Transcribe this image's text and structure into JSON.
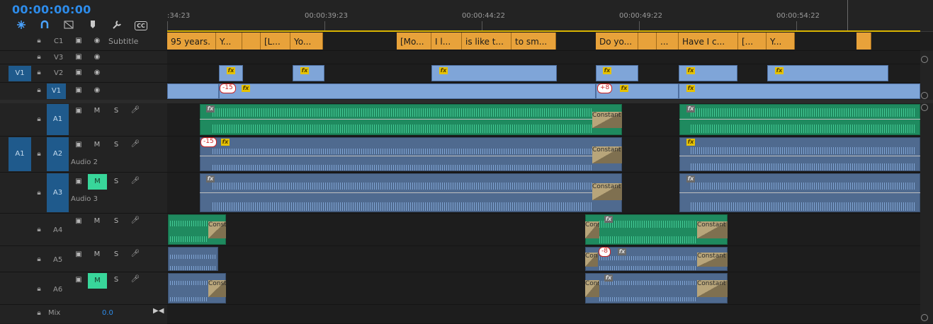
{
  "timecode": "00:00:00:00",
  "toolbar": {
    "snap_icon": "snap-icon",
    "link_icon": "linked-selection-icon",
    "insert_icon": "insert-overwrite-icon",
    "marker_icon": "add-marker-icon",
    "settings_icon": "wrench-icon",
    "captions_label": "CC"
  },
  "ruler": {
    "labels": [
      ":34:23",
      "00:00:39:23",
      "00:00:44:22",
      "00:00:49:22",
      "00:00:54:22"
    ]
  },
  "tracks": {
    "c1": {
      "name": "C1",
      "label": "Subtitle"
    },
    "v3": {
      "name": "V3"
    },
    "v2": {
      "name": "V2",
      "source": "V1"
    },
    "v1": {
      "name": "V1"
    },
    "a1": {
      "name": "A1",
      "mute": "M",
      "solo": "S"
    },
    "a2": {
      "name": "A2",
      "source": "A1",
      "mute": "M",
      "solo": "S",
      "label": "Audio 2"
    },
    "a3": {
      "name": "A3",
      "mute": "M",
      "solo": "S",
      "label": "Audio 3"
    },
    "a4": {
      "name": "A4",
      "mute": "M",
      "solo": "S"
    },
    "a5": {
      "name": "A5",
      "mute": "M",
      "solo": "S"
    },
    "a6": {
      "name": "A6",
      "mute": "M",
      "solo": "S"
    }
  },
  "mix": {
    "label": "Mix",
    "value": "0.0"
  },
  "captions": [
    {
      "text": "95 years."
    },
    {
      "text": "Y..."
    },
    {
      "text": "[L..."
    },
    {
      "text": "Yo..."
    },
    {
      "text": "[Mo..."
    },
    {
      "text": "I l..."
    },
    {
      "text": "is like t..."
    },
    {
      "text": "to sm..."
    },
    {
      "text": "Do yo..."
    },
    {
      "text": "..."
    },
    {
      "text": "Have I c..."
    },
    {
      "text": "[..."
    },
    {
      "text": "Y..."
    }
  ],
  "fx_label": "fx",
  "offsets": {
    "v1_a": "-15",
    "v1_b": "+8",
    "a2": "-15",
    "a5": "-8"
  },
  "transition_label": "Constant Power",
  "transition_label_short": "Cons",
  "colors": {
    "timecode": "#2d8ceb",
    "caption_clip": "#e8a23a",
    "video_clip": "#7fa5d8",
    "audio_green": "#1f8a5f",
    "audio_blue": "#4f6a8f",
    "mute_active": "#38d69a",
    "work_area": "#d9b400"
  }
}
